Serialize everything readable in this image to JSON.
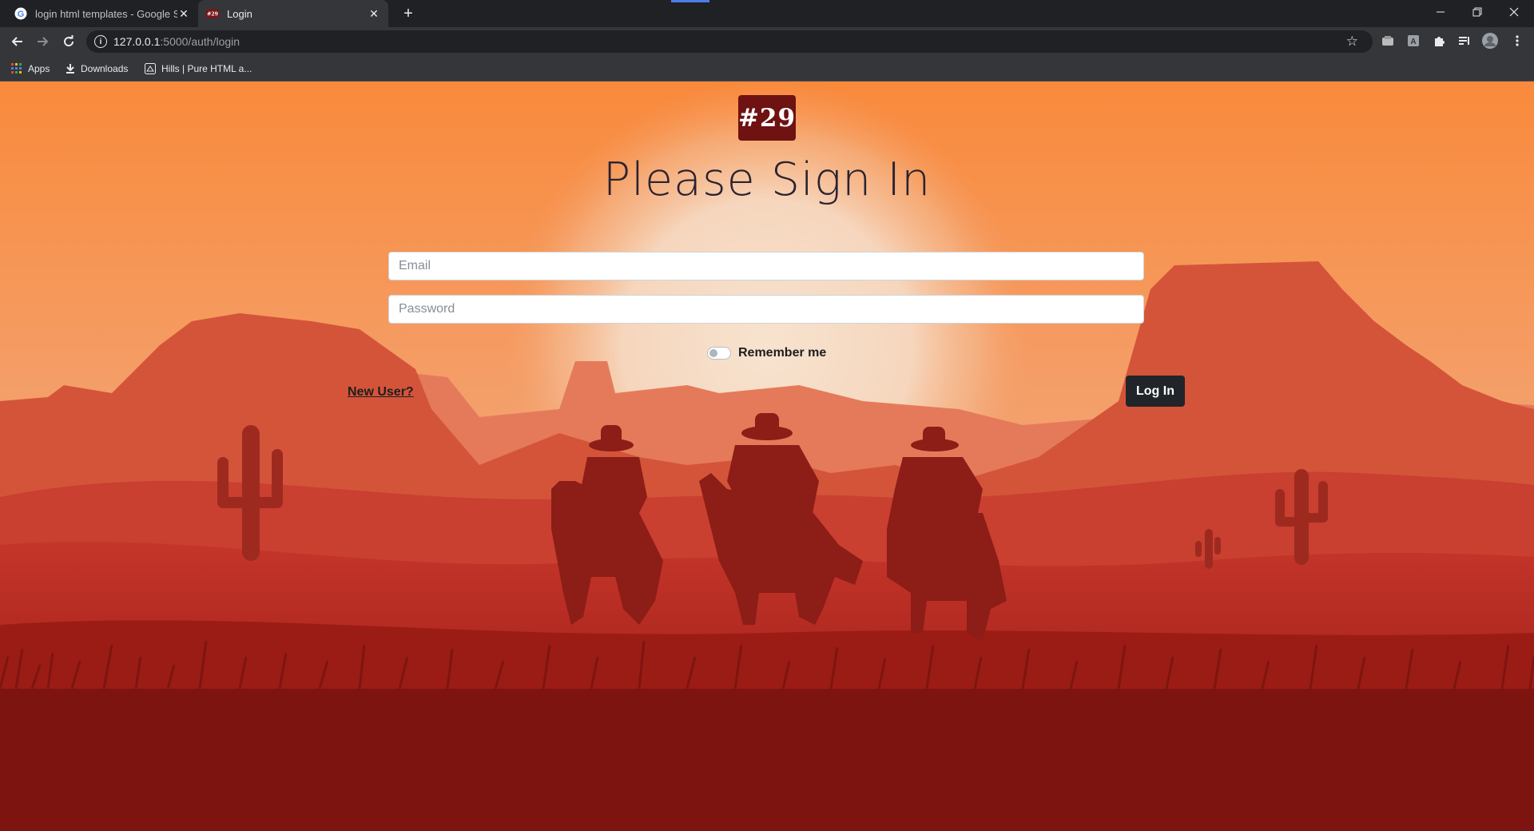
{
  "browser": {
    "tabs": [
      {
        "title": "login html templates - Google Se",
        "favicon": "google-g-icon"
      },
      {
        "title": "Login",
        "favicon": "site-29-icon",
        "favicon_text": "#29"
      }
    ],
    "address": {
      "host": "127.0.0.1",
      "rest": ":5000/auth/login"
    },
    "bookmarks": [
      {
        "label": "Apps",
        "icon": "apps-grid-icon"
      },
      {
        "label": "Downloads",
        "icon": "download-icon"
      },
      {
        "label": "Hills | Pure HTML a...",
        "icon": "hills-site-icon"
      }
    ]
  },
  "page": {
    "logo_text": "#29",
    "heading": "Please Sign In",
    "email_placeholder": "Email",
    "password_placeholder": "Password",
    "remember_label": "Remember me",
    "remember_checked": false,
    "new_user_link": "New User?",
    "login_button": "Log In"
  },
  "colors": {
    "browser_dark": "#202124",
    "browser_toolbar": "#35363a",
    "sky_top": "#f98d3f",
    "sun_glow": "#f6dcc5",
    "ground_red": "#a11b14",
    "logo_bg": "#6e1212",
    "button_bg": "#212529"
  }
}
